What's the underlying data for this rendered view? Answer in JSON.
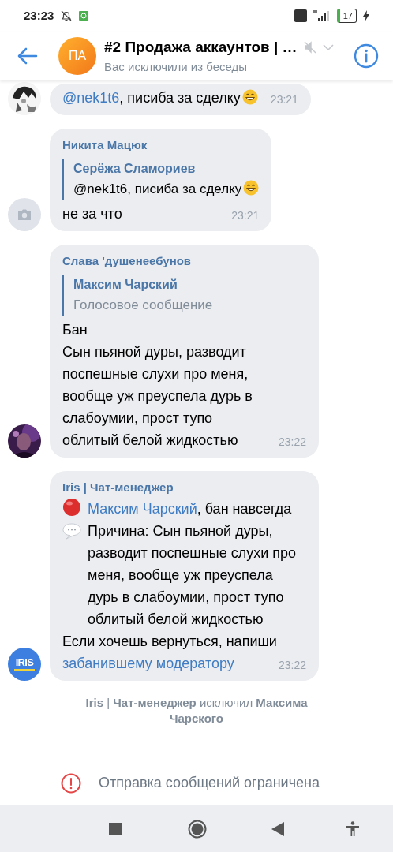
{
  "status_bar": {
    "time": "23:23",
    "battery": "17"
  },
  "header": {
    "avatar_initials": "ПА",
    "title": "#2 Продажа аккаунтов | …",
    "subtitle": "Вас исключили из беседы",
    "muted": true
  },
  "messages": [
    {
      "avatar": {
        "kind": "picture"
      },
      "lines": [
        [
          {
            "kind": "link",
            "text": "@nek1t6"
          },
          {
            "kind": "text",
            "text": ", писиба за сделку"
          },
          {
            "kind": "grin"
          }
        ]
      ],
      "time": "23:21"
    },
    {
      "avatar": {
        "kind": "camera"
      },
      "sender": "Никита Мацюк",
      "reply": {
        "author": "Серёжа Сламориев",
        "kind": "text",
        "lines": [
          [
            {
              "kind": "text",
              "text": "@nek1t6, писиба за сделку"
            },
            {
              "kind": "grin"
            }
          ]
        ]
      },
      "lines": [
        [
          {
            "kind": "text",
            "text": "не за что"
          }
        ]
      ],
      "time": "23:21"
    },
    {
      "avatar": {
        "kind": "picture"
      },
      "sender": "Слава 'душенеебунов",
      "reply": {
        "author": "Максим Чарский",
        "kind": "attachment",
        "lines": [
          [
            {
              "kind": "text",
              "text": "Голосовое сообщение"
            }
          ]
        ]
      },
      "lines": [
        [
          {
            "kind": "text",
            "text": "Бан"
          }
        ],
        [
          {
            "kind": "text",
            "text": "Сын пьяной дуры, разводит поспешные слухи про меня, вообще уж преуспела дурь в слабоумии, прост тупо облитый белой жидкостью"
          }
        ]
      ],
      "time": "23:22"
    },
    {
      "avatar": {
        "kind": "logo",
        "text": "IRIS"
      },
      "sender": "Iris | Чат-менеджер",
      "lines": [
        [
          {
            "kind": "red-dot"
          },
          {
            "kind": "link",
            "text": "Максим Чарский"
          },
          {
            "kind": "text",
            "text": ", бан навсегда"
          }
        ],
        [
          {
            "kind": "speech"
          },
          {
            "kind": "text",
            "text": "Причина: Сын пьяной дуры, разводит поспешные слухи про меня, вообще уж преуспела дурь в слабоумии, прост тупо облитый белой жидкостью"
          }
        ],
        [
          {
            "kind": "text",
            "text": "Если хочешь вернуться, напиши"
          }
        ],
        [
          {
            "kind": "link",
            "text": "забанившему модератору"
          }
        ]
      ],
      "time": "23:22"
    }
  ],
  "system_message": "**Iris** | **Чат-менеджер** исключил **Максима Чарского**",
  "restriction": "Отправка сообщений ограничена"
}
